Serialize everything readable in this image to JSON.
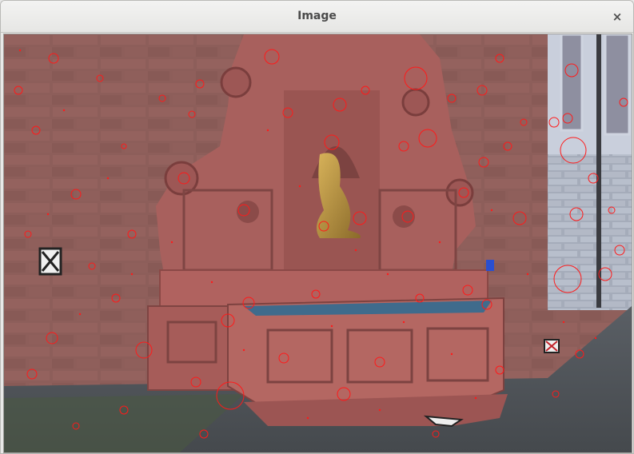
{
  "window": {
    "title": "Image",
    "close_glyph": "×"
  },
  "image": {
    "subject": "stone-fountain-with-dolphin",
    "keypoint_color": "#ff0000",
    "wall_color": "#8a5b57",
    "fountain_color": "#b1615f",
    "water_color": "#3f6b8c",
    "ground_color": "#4d5256"
  }
}
